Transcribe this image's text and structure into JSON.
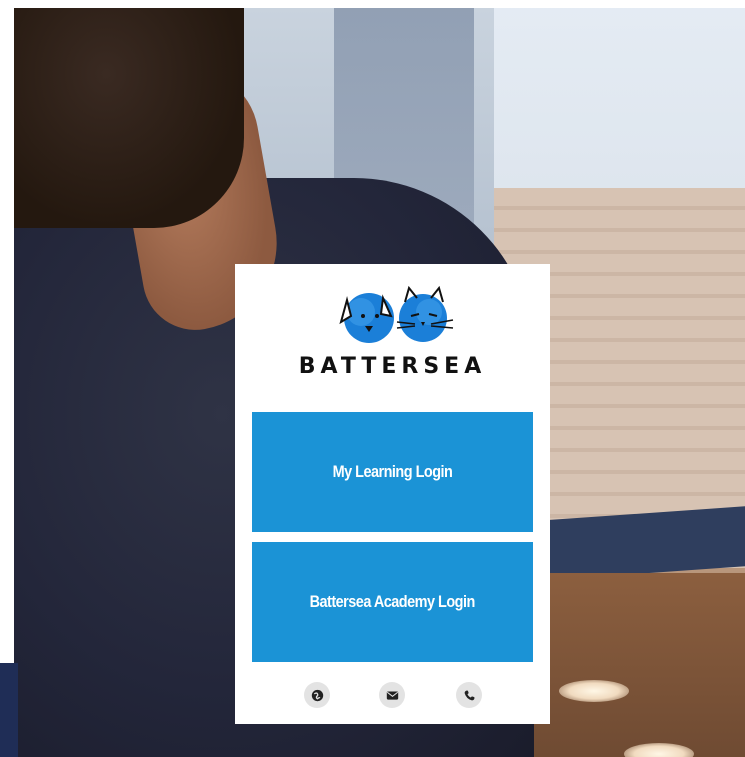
{
  "brand": {
    "name": "BATTERSEA",
    "logo_icon": "dog-and-cat-logo",
    "accent_color": "#1b93d6"
  },
  "login_options": [
    {
      "label": "My Learning Login"
    },
    {
      "label": "Battersea Academy Login"
    }
  ],
  "contact_icons": [
    "globe-icon",
    "envelope-icon",
    "phone-icon"
  ]
}
